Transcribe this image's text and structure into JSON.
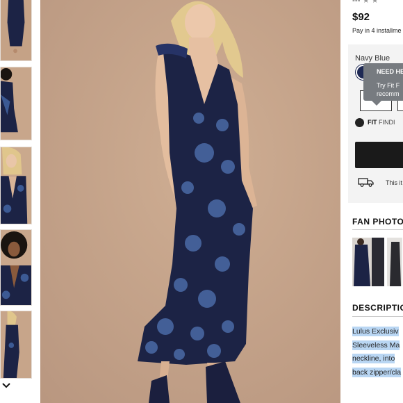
{
  "product": {
    "rating_fragment": "▪▪▪ ★ ★",
    "price": "$92",
    "payment_line": "Pay in 4 installme",
    "color_label": "Navy Blue",
    "colors": {
      "swatch": "#1f2a55",
      "dress": "#1c2345",
      "lace": "#4a6aa6",
      "background": "#c7a58a"
    }
  },
  "tooltip": {
    "title": "NEED HE",
    "body_line1": "Try Fit F",
    "body_line2": "recomm"
  },
  "fit_finder": {
    "brand": "FIT",
    "rest": "FINDI"
  },
  "shipping": {
    "text": "This it"
  },
  "fan_photos": {
    "title": "FAN PHOTO"
  },
  "description": {
    "title": "DESCRIPTIO",
    "lines": [
      "Lulus Exclusiv",
      "Sleeveless Ma",
      "neckline, into",
      "back zipper/cla"
    ]
  },
  "thumbnails": {
    "count_visible": 5
  },
  "icons": {
    "rail_down": "chevron-down-icon",
    "zoom": "zoom-icon",
    "fit": "fit-finder-icon",
    "shipping": "truck-icon"
  }
}
